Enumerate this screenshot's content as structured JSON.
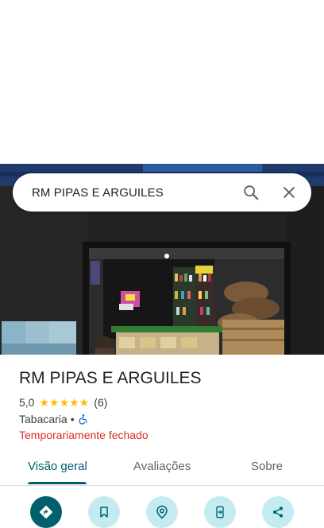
{
  "search": {
    "query": "RM PIPAS E ARGUILES"
  },
  "place": {
    "name": "RM PIPAS E ARGUILES",
    "rating": "5,0",
    "stars": 5,
    "review_count": "(6)",
    "category": "Tabacaria",
    "separator": "•",
    "status": "Temporariamente fechado"
  },
  "tabs": [
    {
      "label": "Visão geral",
      "active": true
    },
    {
      "label": "Avaliações",
      "active": false
    },
    {
      "label": "Sobre",
      "active": false
    }
  ],
  "actions": [
    {
      "icon": "directions-icon"
    },
    {
      "icon": "bookmark-icon"
    },
    {
      "icon": "nearby-icon"
    },
    {
      "icon": "send-to-phone-icon"
    },
    {
      "icon": "share-icon"
    }
  ],
  "colors": {
    "accent": "#00606e",
    "accent_light": "#c4ebf1",
    "closed": "#d93025",
    "star": "#fbbc04"
  }
}
